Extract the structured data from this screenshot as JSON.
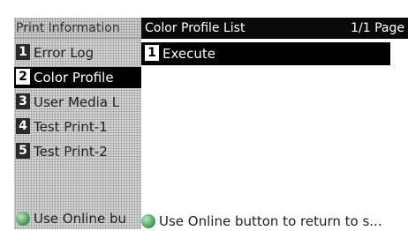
{
  "left_panel": {
    "header": "Print Information",
    "items": [
      {
        "num": "1",
        "label": "Error Log"
      },
      {
        "num": "2",
        "label": "Color Profile"
      },
      {
        "num": "3",
        "label": "User Media L"
      },
      {
        "num": "4",
        "label": "Test Print-1"
      },
      {
        "num": "5",
        "label": "Test Print-2"
      }
    ],
    "footer": "Use Online bu"
  },
  "right_panel": {
    "title": "Color Profile List",
    "page_indicator": "1/1 Page",
    "items": [
      {
        "num": "1",
        "label": "Execute"
      }
    ],
    "footer": "Use Online button to return to s..."
  },
  "colors": {
    "selected_bg": "#000000",
    "led_green": "#4aa15a"
  }
}
